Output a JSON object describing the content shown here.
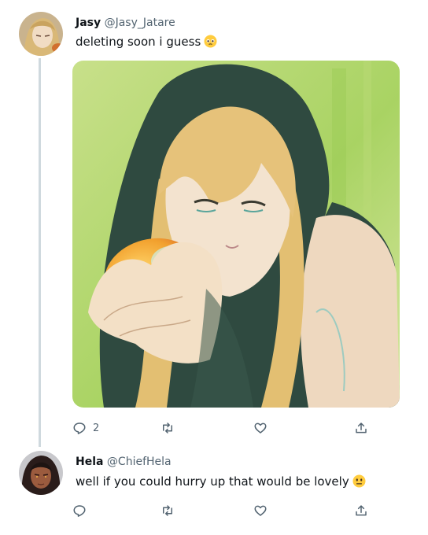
{
  "colors": {
    "text": "#0f1419",
    "secondary": "#536471",
    "thread_line": "#cfd9de",
    "hood": "#2f4a40",
    "background_green": "#b6dc6a"
  },
  "tweets": [
    {
      "name": "Jasy",
      "handle": "@Jasy_Jatare",
      "text": "deleting soon i guess",
      "emoji": "pleading-face-emoji",
      "has_media": true,
      "stats": {
        "replies": "2",
        "retweets": "",
        "likes": ""
      }
    },
    {
      "name": "Hela",
      "handle": "@ChiefHela",
      "text": "well if you could hurry up that would be lovely",
      "emoji": "neutral-face-emoji",
      "has_media": false,
      "stats": {
        "replies": "",
        "retweets": "",
        "likes": ""
      }
    }
  ],
  "icons": {
    "reply": "reply-icon",
    "retweet": "retweet-icon",
    "like": "heart-icon",
    "share": "share-icon"
  }
}
